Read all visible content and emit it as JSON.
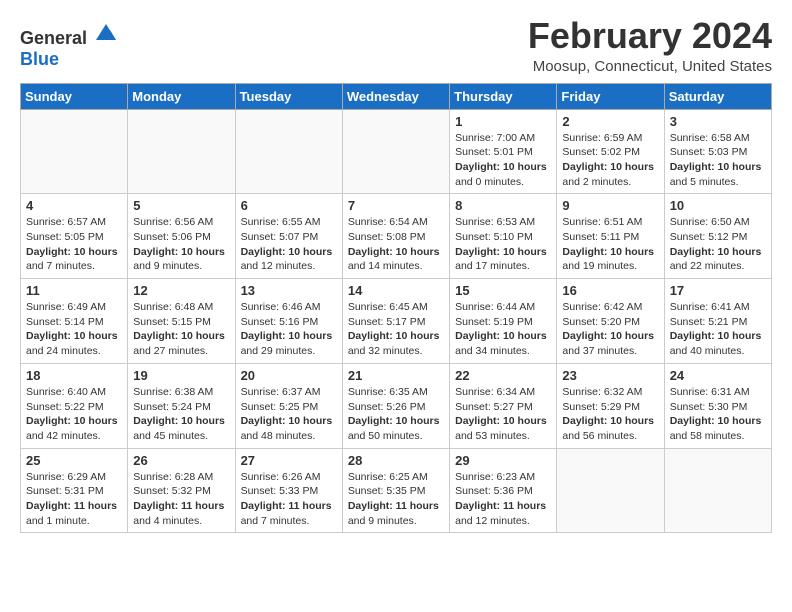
{
  "header": {
    "logo_general": "General",
    "logo_blue": "Blue",
    "title": "February 2024",
    "location": "Moosup, Connecticut, United States"
  },
  "weekdays": [
    "Sunday",
    "Monday",
    "Tuesday",
    "Wednesday",
    "Thursday",
    "Friday",
    "Saturday"
  ],
  "weeks": [
    [
      {
        "day": "",
        "info": ""
      },
      {
        "day": "",
        "info": ""
      },
      {
        "day": "",
        "info": ""
      },
      {
        "day": "",
        "info": ""
      },
      {
        "day": "1",
        "info": "Sunrise: 7:00 AM\nSunset: 5:01 PM\nDaylight: 10 hours\nand 0 minutes."
      },
      {
        "day": "2",
        "info": "Sunrise: 6:59 AM\nSunset: 5:02 PM\nDaylight: 10 hours\nand 2 minutes."
      },
      {
        "day": "3",
        "info": "Sunrise: 6:58 AM\nSunset: 5:03 PM\nDaylight: 10 hours\nand 5 minutes."
      }
    ],
    [
      {
        "day": "4",
        "info": "Sunrise: 6:57 AM\nSunset: 5:05 PM\nDaylight: 10 hours\nand 7 minutes."
      },
      {
        "day": "5",
        "info": "Sunrise: 6:56 AM\nSunset: 5:06 PM\nDaylight: 10 hours\nand 9 minutes."
      },
      {
        "day": "6",
        "info": "Sunrise: 6:55 AM\nSunset: 5:07 PM\nDaylight: 10 hours\nand 12 minutes."
      },
      {
        "day": "7",
        "info": "Sunrise: 6:54 AM\nSunset: 5:08 PM\nDaylight: 10 hours\nand 14 minutes."
      },
      {
        "day": "8",
        "info": "Sunrise: 6:53 AM\nSunset: 5:10 PM\nDaylight: 10 hours\nand 17 minutes."
      },
      {
        "day": "9",
        "info": "Sunrise: 6:51 AM\nSunset: 5:11 PM\nDaylight: 10 hours\nand 19 minutes."
      },
      {
        "day": "10",
        "info": "Sunrise: 6:50 AM\nSunset: 5:12 PM\nDaylight: 10 hours\nand 22 minutes."
      }
    ],
    [
      {
        "day": "11",
        "info": "Sunrise: 6:49 AM\nSunset: 5:14 PM\nDaylight: 10 hours\nand 24 minutes."
      },
      {
        "day": "12",
        "info": "Sunrise: 6:48 AM\nSunset: 5:15 PM\nDaylight: 10 hours\nand 27 minutes."
      },
      {
        "day": "13",
        "info": "Sunrise: 6:46 AM\nSunset: 5:16 PM\nDaylight: 10 hours\nand 29 minutes."
      },
      {
        "day": "14",
        "info": "Sunrise: 6:45 AM\nSunset: 5:17 PM\nDaylight: 10 hours\nand 32 minutes."
      },
      {
        "day": "15",
        "info": "Sunrise: 6:44 AM\nSunset: 5:19 PM\nDaylight: 10 hours\nand 34 minutes."
      },
      {
        "day": "16",
        "info": "Sunrise: 6:42 AM\nSunset: 5:20 PM\nDaylight: 10 hours\nand 37 minutes."
      },
      {
        "day": "17",
        "info": "Sunrise: 6:41 AM\nSunset: 5:21 PM\nDaylight: 10 hours\nand 40 minutes."
      }
    ],
    [
      {
        "day": "18",
        "info": "Sunrise: 6:40 AM\nSunset: 5:22 PM\nDaylight: 10 hours\nand 42 minutes."
      },
      {
        "day": "19",
        "info": "Sunrise: 6:38 AM\nSunset: 5:24 PM\nDaylight: 10 hours\nand 45 minutes."
      },
      {
        "day": "20",
        "info": "Sunrise: 6:37 AM\nSunset: 5:25 PM\nDaylight: 10 hours\nand 48 minutes."
      },
      {
        "day": "21",
        "info": "Sunrise: 6:35 AM\nSunset: 5:26 PM\nDaylight: 10 hours\nand 50 minutes."
      },
      {
        "day": "22",
        "info": "Sunrise: 6:34 AM\nSunset: 5:27 PM\nDaylight: 10 hours\nand 53 minutes."
      },
      {
        "day": "23",
        "info": "Sunrise: 6:32 AM\nSunset: 5:29 PM\nDaylight: 10 hours\nand 56 minutes."
      },
      {
        "day": "24",
        "info": "Sunrise: 6:31 AM\nSunset: 5:30 PM\nDaylight: 10 hours\nand 58 minutes."
      }
    ],
    [
      {
        "day": "25",
        "info": "Sunrise: 6:29 AM\nSunset: 5:31 PM\nDaylight: 11 hours\nand 1 minute."
      },
      {
        "day": "26",
        "info": "Sunrise: 6:28 AM\nSunset: 5:32 PM\nDaylight: 11 hours\nand 4 minutes."
      },
      {
        "day": "27",
        "info": "Sunrise: 6:26 AM\nSunset: 5:33 PM\nDaylight: 11 hours\nand 7 minutes."
      },
      {
        "day": "28",
        "info": "Sunrise: 6:25 AM\nSunset: 5:35 PM\nDaylight: 11 hours\nand 9 minutes."
      },
      {
        "day": "29",
        "info": "Sunrise: 6:23 AM\nSunset: 5:36 PM\nDaylight: 11 hours\nand 12 minutes."
      },
      {
        "day": "",
        "info": ""
      },
      {
        "day": "",
        "info": ""
      }
    ]
  ]
}
